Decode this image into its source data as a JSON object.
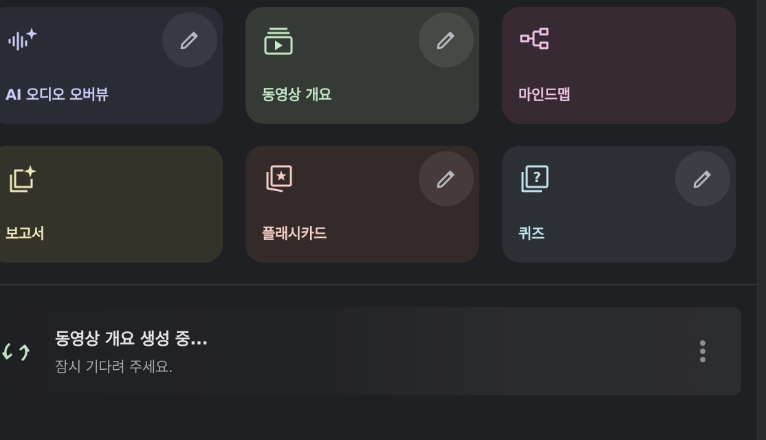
{
  "studio_cards": [
    {
      "label": "AI 오디오 오버뷰",
      "icon": "audio-sparkle-icon",
      "has_edit": true,
      "bg": "#2a2c35",
      "fg": "#c7cbf5",
      "edit_bg": "#373944"
    },
    {
      "label": "동영상 개요",
      "icon": "video-overview-icon",
      "has_edit": true,
      "bg": "#363a36",
      "fg": "#c2e8c4",
      "edit_bg": "#454a45"
    },
    {
      "label": "마인드맵",
      "icon": "mind-map-icon",
      "has_edit": false,
      "bg": "#372a32",
      "fg": "#efc2e4",
      "edit_bg": "#473943"
    },
    {
      "label": "보고서",
      "icon": "report-sparkle-icon",
      "has_edit": false,
      "bg": "#33332a",
      "fg": "#ece6b5",
      "edit_bg": "#43433a"
    },
    {
      "label": "플래시카드",
      "icon": "flashcards-icon",
      "has_edit": true,
      "bg": "#352a2a",
      "fg": "#f3cdc6",
      "edit_bg": "#463a3a"
    },
    {
      "label": "퀴즈",
      "icon": "quiz-icon",
      "has_edit": true,
      "bg": "#2c3034",
      "fg": "#bfe4ec",
      "edit_bg": "#3b3f43"
    }
  ],
  "edit_icon": "pencil-icon",
  "status": {
    "title": "동영상 개요 생성 중...",
    "subtitle": "잠시 기다려 주세요.",
    "icon": "sync-icon",
    "icon_color": "#bfe4c1",
    "menu_icon": "more-vert-icon"
  }
}
